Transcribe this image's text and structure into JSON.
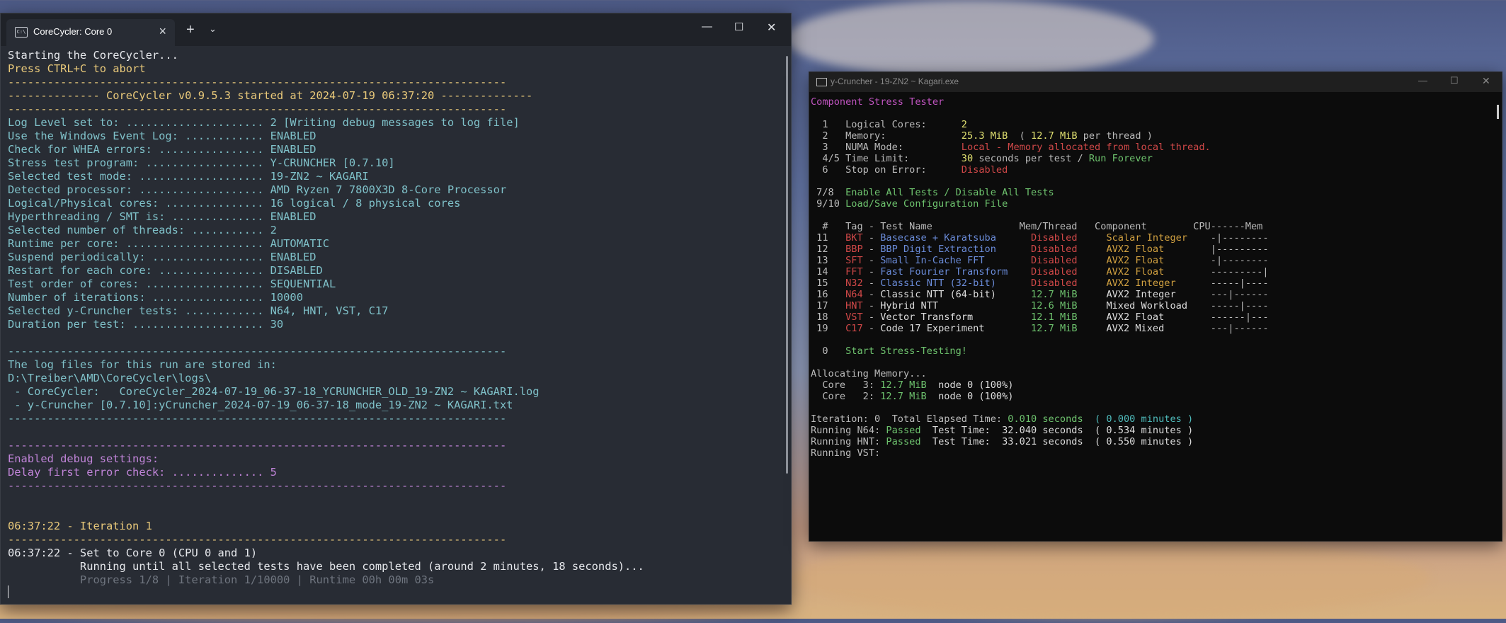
{
  "terminal": {
    "tab_title": "CoreCycler: Core 0",
    "tab_icon": "terminal-icon",
    "new_tab": "+",
    "dropdown": "⌄",
    "win_min": "—",
    "win_max": "☐",
    "win_close": "✕",
    "lines": [
      {
        "parts": [
          {
            "t": "Starting the CoreCycler...",
            "c": "c-w"
          }
        ]
      },
      {
        "parts": [
          {
            "t": "Press CTRL+C to abort",
            "c": "c-y"
          }
        ]
      },
      {
        "parts": [
          {
            "t": "----------------------------------------------------------------------------",
            "c": "c-hdr"
          }
        ]
      },
      {
        "parts": [
          {
            "t": "-------------- CoreCycler v0.9.5.3 started at 2024-07-19 06:37:20 --------------",
            "c": "c-hdr"
          }
        ]
      },
      {
        "parts": [
          {
            "t": "----------------------------------------------------------------------------",
            "c": "c-hdr"
          }
        ]
      },
      {
        "parts": [
          {
            "t": "Log Level set to: ..................... 2 [Writing debug messages to log file]",
            "c": "c-c"
          }
        ]
      },
      {
        "parts": [
          {
            "t": "Use the Windows Event Log: ............ ENABLED",
            "c": "c-c"
          }
        ]
      },
      {
        "parts": [
          {
            "t": "Check for WHEA errors: ................ ENABLED",
            "c": "c-c"
          }
        ]
      },
      {
        "parts": [
          {
            "t": "Stress test program: .................. Y-CRUNCHER [0.7.10]",
            "c": "c-c"
          }
        ]
      },
      {
        "parts": [
          {
            "t": "Selected test mode: ................... 19-ZN2 ~ KAGARI",
            "c": "c-c"
          }
        ]
      },
      {
        "parts": [
          {
            "t": "Detected processor: ................... AMD Ryzen 7 7800X3D 8-Core Processor",
            "c": "c-c"
          }
        ]
      },
      {
        "parts": [
          {
            "t": "Logical/Physical cores: ............... 16 logical / 8 physical cores",
            "c": "c-c"
          }
        ]
      },
      {
        "parts": [
          {
            "t": "Hyperthreading / SMT is: .............. ENABLED",
            "c": "c-c"
          }
        ]
      },
      {
        "parts": [
          {
            "t": "Selected number of threads: ........... 2",
            "c": "c-c"
          }
        ]
      },
      {
        "parts": [
          {
            "t": "Runtime per core: ..................... AUTOMATIC",
            "c": "c-c"
          }
        ]
      },
      {
        "parts": [
          {
            "t": "Suspend periodically: ................. ENABLED",
            "c": "c-c"
          }
        ]
      },
      {
        "parts": [
          {
            "t": "Restart for each core: ................ DISABLED",
            "c": "c-c"
          }
        ]
      },
      {
        "parts": [
          {
            "t": "Test order of cores: .................. SEQUENTIAL",
            "c": "c-c"
          }
        ]
      },
      {
        "parts": [
          {
            "t": "Number of iterations: ................. 10000",
            "c": "c-c"
          }
        ]
      },
      {
        "parts": [
          {
            "t": "Selected y-Cruncher tests: ............ N64, HNT, VST, C17",
            "c": "c-c"
          }
        ]
      },
      {
        "parts": [
          {
            "t": "Duration per test: .................... 30",
            "c": "c-c"
          }
        ]
      },
      {
        "parts": [
          {
            "t": "",
            "c": "c-w"
          }
        ]
      },
      {
        "parts": [
          {
            "t": "----------------------------------------------------------------------------",
            "c": "c-c"
          }
        ]
      },
      {
        "parts": [
          {
            "t": "The log files for this run are stored in:",
            "c": "c-c"
          }
        ]
      },
      {
        "parts": [
          {
            "t": "D:\\Treiber\\AMD\\CoreCycler\\logs\\",
            "c": "c-c"
          }
        ]
      },
      {
        "parts": [
          {
            "t": " - CoreCycler:   CoreCycler_2024-07-19_06-37-18_YCRUNCHER_OLD_19-ZN2 ~ KAGARI.log",
            "c": "c-c"
          }
        ]
      },
      {
        "parts": [
          {
            "t": " - y-Cruncher [0.7.10]:yCruncher_2024-07-19_06-37-18_mode_19-ZN2 ~ KAGARI.txt",
            "c": "c-c"
          }
        ]
      },
      {
        "parts": [
          {
            "t": "----------------------------------------------------------------------------",
            "c": "c-c"
          }
        ]
      },
      {
        "parts": [
          {
            "t": "",
            "c": "c-w"
          }
        ]
      },
      {
        "parts": [
          {
            "t": "----------------------------------------------------------------------------",
            "c": "c-m"
          }
        ]
      },
      {
        "parts": [
          {
            "t": "Enabled debug settings:",
            "c": "c-m"
          }
        ]
      },
      {
        "parts": [
          {
            "t": "Delay first error check: .............. 5",
            "c": "c-m"
          }
        ]
      },
      {
        "parts": [
          {
            "t": "----------------------------------------------------------------------------",
            "c": "c-m"
          }
        ]
      },
      {
        "parts": [
          {
            "t": "",
            "c": "c-w"
          }
        ]
      },
      {
        "parts": [
          {
            "t": "",
            "c": "c-w"
          }
        ]
      },
      {
        "parts": [
          {
            "t": "06:37:22 - Iteration 1",
            "c": "c-y"
          }
        ]
      },
      {
        "parts": [
          {
            "t": "----------------------------------------------------------------------------",
            "c": "c-y"
          }
        ]
      },
      {
        "parts": [
          {
            "t": "06:37:22 - Set to Core 0 (CPU 0 and 1)",
            "c": "c-w"
          }
        ]
      },
      {
        "parts": [
          {
            "t": "           Running until all selected tests have been completed (around 2 minutes, 18 seconds)...",
            "c": "c-w"
          }
        ]
      },
      {
        "parts": [
          {
            "t": "           Progress 1/8 | Iteration 1/10000 | Runtime 00h 00m 03s",
            "c": "c-dim"
          }
        ]
      }
    ]
  },
  "ycruncher": {
    "title": "y-Cruncher - 19-ZN2 ~ Kagari.exe",
    "win_min": "—",
    "win_max": "☐",
    "win_close": "✕",
    "lines": [
      {
        "parts": [
          {
            "t": "Component Stress Tester",
            "c": "y-mag"
          }
        ]
      },
      {
        "parts": [
          {
            "t": "",
            "c": "y-gry"
          }
        ]
      },
      {
        "parts": [
          {
            "t": "  1   Logical Cores:      ",
            "c": "y-gry"
          },
          {
            "t": "2",
            "c": "y-yel"
          }
        ]
      },
      {
        "parts": [
          {
            "t": "  2   Memory:             ",
            "c": "y-gry"
          },
          {
            "t": "25.3 MiB",
            "c": "y-yel"
          },
          {
            "t": "  ( ",
            "c": "y-gry"
          },
          {
            "t": "12.7 MiB",
            "c": "y-yel"
          },
          {
            "t": " per thread )",
            "c": "y-gry"
          }
        ]
      },
      {
        "parts": [
          {
            "t": "  3   NUMA Mode:          ",
            "c": "y-gry"
          },
          {
            "t": "Local - Memory allocated from local thread.",
            "c": "y-red"
          }
        ]
      },
      {
        "parts": [
          {
            "t": "  4/5 Time Limit:         ",
            "c": "y-gry"
          },
          {
            "t": "30",
            "c": "y-yel"
          },
          {
            "t": " seconds per test / ",
            "c": "y-gry"
          },
          {
            "t": "Run Forever",
            "c": "y-grn"
          }
        ]
      },
      {
        "parts": [
          {
            "t": "  6   Stop on Error:      ",
            "c": "y-gry"
          },
          {
            "t": "Disabled",
            "c": "y-red"
          }
        ]
      },
      {
        "parts": [
          {
            "t": "",
            "c": "y-gry"
          }
        ]
      },
      {
        "parts": [
          {
            "t": " 7/8  ",
            "c": "y-gry"
          },
          {
            "t": "Enable All Tests / Disable All Tests",
            "c": "y-grn"
          }
        ]
      },
      {
        "parts": [
          {
            "t": " 9/10 ",
            "c": "y-gry"
          },
          {
            "t": "Load/Save Configuration File",
            "c": "y-grn"
          }
        ]
      },
      {
        "parts": [
          {
            "t": "",
            "c": "y-gry"
          }
        ]
      },
      {
        "parts": [
          {
            "t": "  #   Tag - Test Name               Mem/Thread   Component        CPU------Mem",
            "c": "y-gry"
          }
        ]
      },
      {
        "parts": [
          {
            "t": " 11   ",
            "c": "y-gry"
          },
          {
            "t": "BKT",
            "c": "y-red"
          },
          {
            "t": " - ",
            "c": "y-gry"
          },
          {
            "t": "Basecase + Karatsuba      ",
            "c": "y-blu"
          },
          {
            "t": "Disabled     ",
            "c": "y-red"
          },
          {
            "t": "Scalar Integer   ",
            "c": "y-ora"
          },
          {
            "t": " -|--------",
            "c": "y-gry"
          }
        ]
      },
      {
        "parts": [
          {
            "t": " 12   ",
            "c": "y-gry"
          },
          {
            "t": "BBP",
            "c": "y-red"
          },
          {
            "t": " - ",
            "c": "y-gry"
          },
          {
            "t": "BBP Digit Extraction      ",
            "c": "y-blu"
          },
          {
            "t": "Disabled     ",
            "c": "y-red"
          },
          {
            "t": "AVX2 Float       ",
            "c": "y-ora"
          },
          {
            "t": " |---------",
            "c": "y-gry"
          }
        ]
      },
      {
        "parts": [
          {
            "t": " 13   ",
            "c": "y-gry"
          },
          {
            "t": "SFT",
            "c": "y-red"
          },
          {
            "t": " - ",
            "c": "y-gry"
          },
          {
            "t": "Small In-Cache FFT        ",
            "c": "y-blu"
          },
          {
            "t": "Disabled     ",
            "c": "y-red"
          },
          {
            "t": "AVX2 Float       ",
            "c": "y-ora"
          },
          {
            "t": " -|--------",
            "c": "y-gry"
          }
        ]
      },
      {
        "parts": [
          {
            "t": " 14   ",
            "c": "y-gry"
          },
          {
            "t": "FFT",
            "c": "y-red"
          },
          {
            "t": " - ",
            "c": "y-gry"
          },
          {
            "t": "Fast Fourier Transform    ",
            "c": "y-blu"
          },
          {
            "t": "Disabled     ",
            "c": "y-red"
          },
          {
            "t": "AVX2 Float       ",
            "c": "y-ora"
          },
          {
            "t": " ---------|",
            "c": "y-gry"
          }
        ]
      },
      {
        "parts": [
          {
            "t": " 15   ",
            "c": "y-gry"
          },
          {
            "t": "N32",
            "c": "y-red"
          },
          {
            "t": " - ",
            "c": "y-gry"
          },
          {
            "t": "Classic NTT (32-bit)      ",
            "c": "y-blu"
          },
          {
            "t": "Disabled     ",
            "c": "y-red"
          },
          {
            "t": "AVX2 Integer     ",
            "c": "y-ora"
          },
          {
            "t": " -----|----",
            "c": "y-gry"
          }
        ]
      },
      {
        "parts": [
          {
            "t": " 16   ",
            "c": "y-gry"
          },
          {
            "t": "N64",
            "c": "y-red"
          },
          {
            "t": " - ",
            "c": "y-gry"
          },
          {
            "t": "Classic NTT (64-bit)      ",
            "c": "y-wht"
          },
          {
            "t": "12.7 MiB     ",
            "c": "y-grn"
          },
          {
            "t": "AVX2 Integer     ",
            "c": "y-wht"
          },
          {
            "t": " ---|------",
            "c": "y-gry"
          }
        ]
      },
      {
        "parts": [
          {
            "t": " 17   ",
            "c": "y-gry"
          },
          {
            "t": "HNT",
            "c": "y-red"
          },
          {
            "t": " - ",
            "c": "y-gry"
          },
          {
            "t": "Hybrid NTT                ",
            "c": "y-wht"
          },
          {
            "t": "12.6 MiB     ",
            "c": "y-grn"
          },
          {
            "t": "Mixed Workload   ",
            "c": "y-wht"
          },
          {
            "t": " -----|----",
            "c": "y-gry"
          }
        ]
      },
      {
        "parts": [
          {
            "t": " 18   ",
            "c": "y-gry"
          },
          {
            "t": "VST",
            "c": "y-red"
          },
          {
            "t": " - ",
            "c": "y-gry"
          },
          {
            "t": "Vector Transform          ",
            "c": "y-wht"
          },
          {
            "t": "12.1 MiB     ",
            "c": "y-grn"
          },
          {
            "t": "AVX2 Float       ",
            "c": "y-wht"
          },
          {
            "t": " ------|---",
            "c": "y-gry"
          }
        ]
      },
      {
        "parts": [
          {
            "t": " 19   ",
            "c": "y-gry"
          },
          {
            "t": "C17",
            "c": "y-red"
          },
          {
            "t": " - ",
            "c": "y-gry"
          },
          {
            "t": "Code 17 Experiment        ",
            "c": "y-wht"
          },
          {
            "t": "12.7 MiB     ",
            "c": "y-grn"
          },
          {
            "t": "AVX2 Mixed       ",
            "c": "y-wht"
          },
          {
            "t": " ---|------",
            "c": "y-gry"
          }
        ]
      },
      {
        "parts": [
          {
            "t": "",
            "c": "y-gry"
          }
        ]
      },
      {
        "parts": [
          {
            "t": "  0   ",
            "c": "y-gry"
          },
          {
            "t": "Start Stress-Testing!",
            "c": "y-grn"
          }
        ]
      },
      {
        "parts": [
          {
            "t": "",
            "c": "y-gry"
          }
        ]
      },
      {
        "parts": [
          {
            "t": "Allocating Memory...",
            "c": "y-gry"
          }
        ]
      },
      {
        "parts": [
          {
            "t": "  Core   3: ",
            "c": "y-gry"
          },
          {
            "t": "12.7 MiB",
            "c": "y-grn"
          },
          {
            "t": "  node 0 (100%)",
            "c": "y-wht"
          }
        ]
      },
      {
        "parts": [
          {
            "t": "  Core   2: ",
            "c": "y-gry"
          },
          {
            "t": "12.7 MiB",
            "c": "y-grn"
          },
          {
            "t": "  node 0 (100%)",
            "c": "y-wht"
          }
        ]
      },
      {
        "parts": [
          {
            "t": "",
            "c": "y-gry"
          }
        ]
      },
      {
        "parts": [
          {
            "t": "Iteration: 0  Total Elapsed Time: ",
            "c": "y-gry"
          },
          {
            "t": "0.010 seconds",
            "c": "y-grn"
          },
          {
            "t": "  ( ",
            "c": "y-cyn"
          },
          {
            "t": "0.000 minutes",
            "c": "y-cyn"
          },
          {
            "t": " )",
            "c": "y-cyn"
          }
        ]
      },
      {
        "parts": [
          {
            "t": "Running N64: ",
            "c": "y-gry"
          },
          {
            "t": "Passed",
            "c": "y-grn"
          },
          {
            "t": "  Test Time:  32.040 seconds  ( 0.534 minutes )",
            "c": "y-wht"
          }
        ]
      },
      {
        "parts": [
          {
            "t": "Running HNT: ",
            "c": "y-gry"
          },
          {
            "t": "Passed",
            "c": "y-grn"
          },
          {
            "t": "  Test Time:  33.021 seconds  ( 0.550 minutes )",
            "c": "y-wht"
          }
        ]
      },
      {
        "parts": [
          {
            "t": "Running VST:",
            "c": "y-gry"
          }
        ]
      }
    ]
  }
}
